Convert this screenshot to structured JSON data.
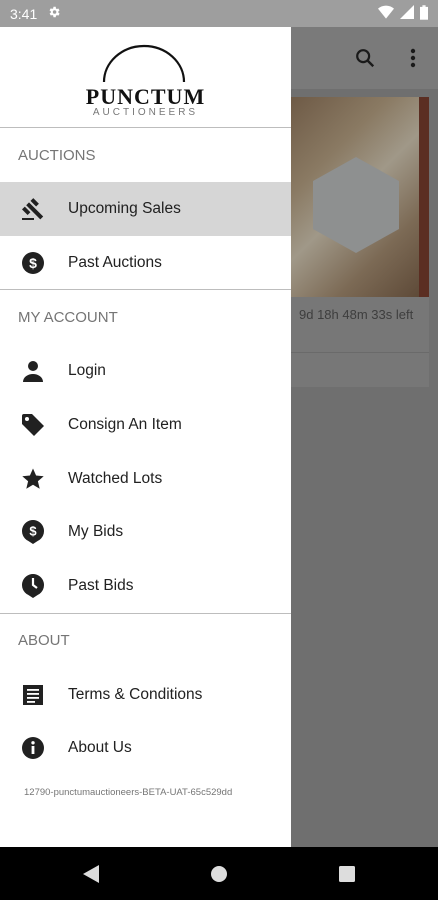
{
  "status_bar": {
    "time": "3:41"
  },
  "logo": {
    "title": "PUNCTUM",
    "subtitle": "AUCTIONEERS"
  },
  "drawer": {
    "sections": [
      {
        "header": "AUCTIONS",
        "items": [
          {
            "label": "Upcoming Sales",
            "icon": "gavel-icon",
            "active": true
          },
          {
            "label": "Past Auctions",
            "icon": "dollar-circle-icon"
          }
        ]
      },
      {
        "header": "MY ACCOUNT",
        "items": [
          {
            "label": "Login",
            "icon": "person-icon"
          },
          {
            "label": "Consign An Item",
            "icon": "tag-icon"
          },
          {
            "label": "Watched Lots",
            "icon": "star-icon"
          },
          {
            "label": "My Bids",
            "icon": "dollar-pin-icon"
          },
          {
            "label": "Past Bids",
            "icon": "clock-pin-icon"
          }
        ]
      },
      {
        "header": "ABOUT",
        "items": [
          {
            "label": "Terms & Conditions",
            "icon": "document-icon"
          },
          {
            "label": "About Us",
            "icon": "info-icon"
          }
        ]
      }
    ],
    "version": "12790-punctumauctioneers-BETA-UAT-65c529dd"
  },
  "background": {
    "card_time_left": "9d 18h 48m 33s left"
  },
  "colors": {
    "drawer_bg": "#ffffff",
    "active_item_bg": "#d6d6d6",
    "scrim": "#6f6f6f"
  }
}
